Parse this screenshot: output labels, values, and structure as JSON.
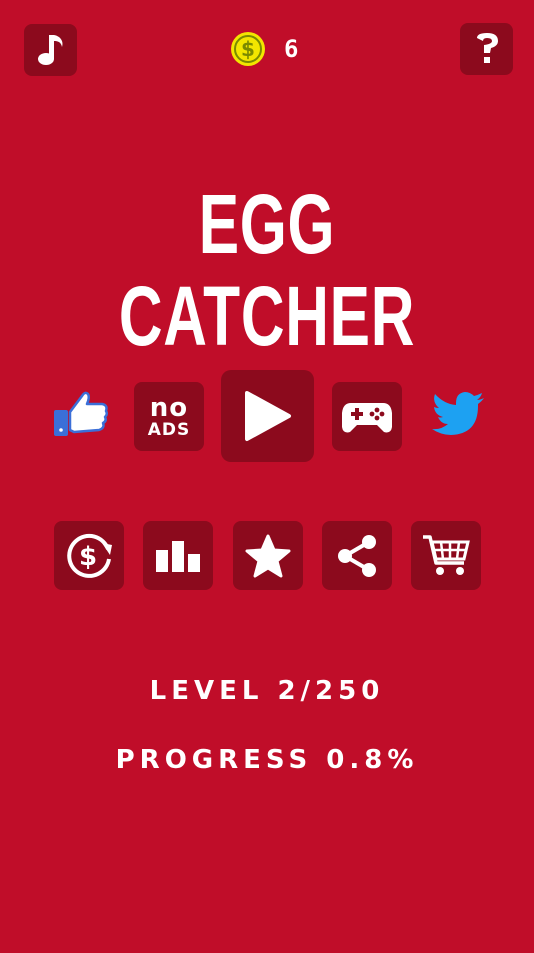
{
  "header": {
    "coins": "6",
    "music_icon": "music-note-icon",
    "help_icon": "question-mark-icon",
    "coin_icon": "dollar-coin-icon"
  },
  "title": "EGG CATCHER",
  "main_row": {
    "like_icon": "thumbs-up-icon",
    "noads": {
      "line1": "no",
      "line2": "ADS"
    },
    "play_icon": "play-icon",
    "games_icon": "gamepad-icon",
    "twitter_icon": "twitter-bird-icon"
  },
  "secondary_row": {
    "icons": [
      "restore-purchase-icon",
      "leaderboard-icon",
      "star-icon",
      "share-icon",
      "cart-icon"
    ]
  },
  "stats": {
    "level_text": "LEVEL 2/250",
    "progress_text": "PROGRESS 0.8%"
  },
  "colors": {
    "background": "#c00d29",
    "tile": "#8c0a1d",
    "coin": "#f2e600",
    "facebook_blue": "#3b6fd8",
    "twitter_blue": "#1da1f2"
  }
}
